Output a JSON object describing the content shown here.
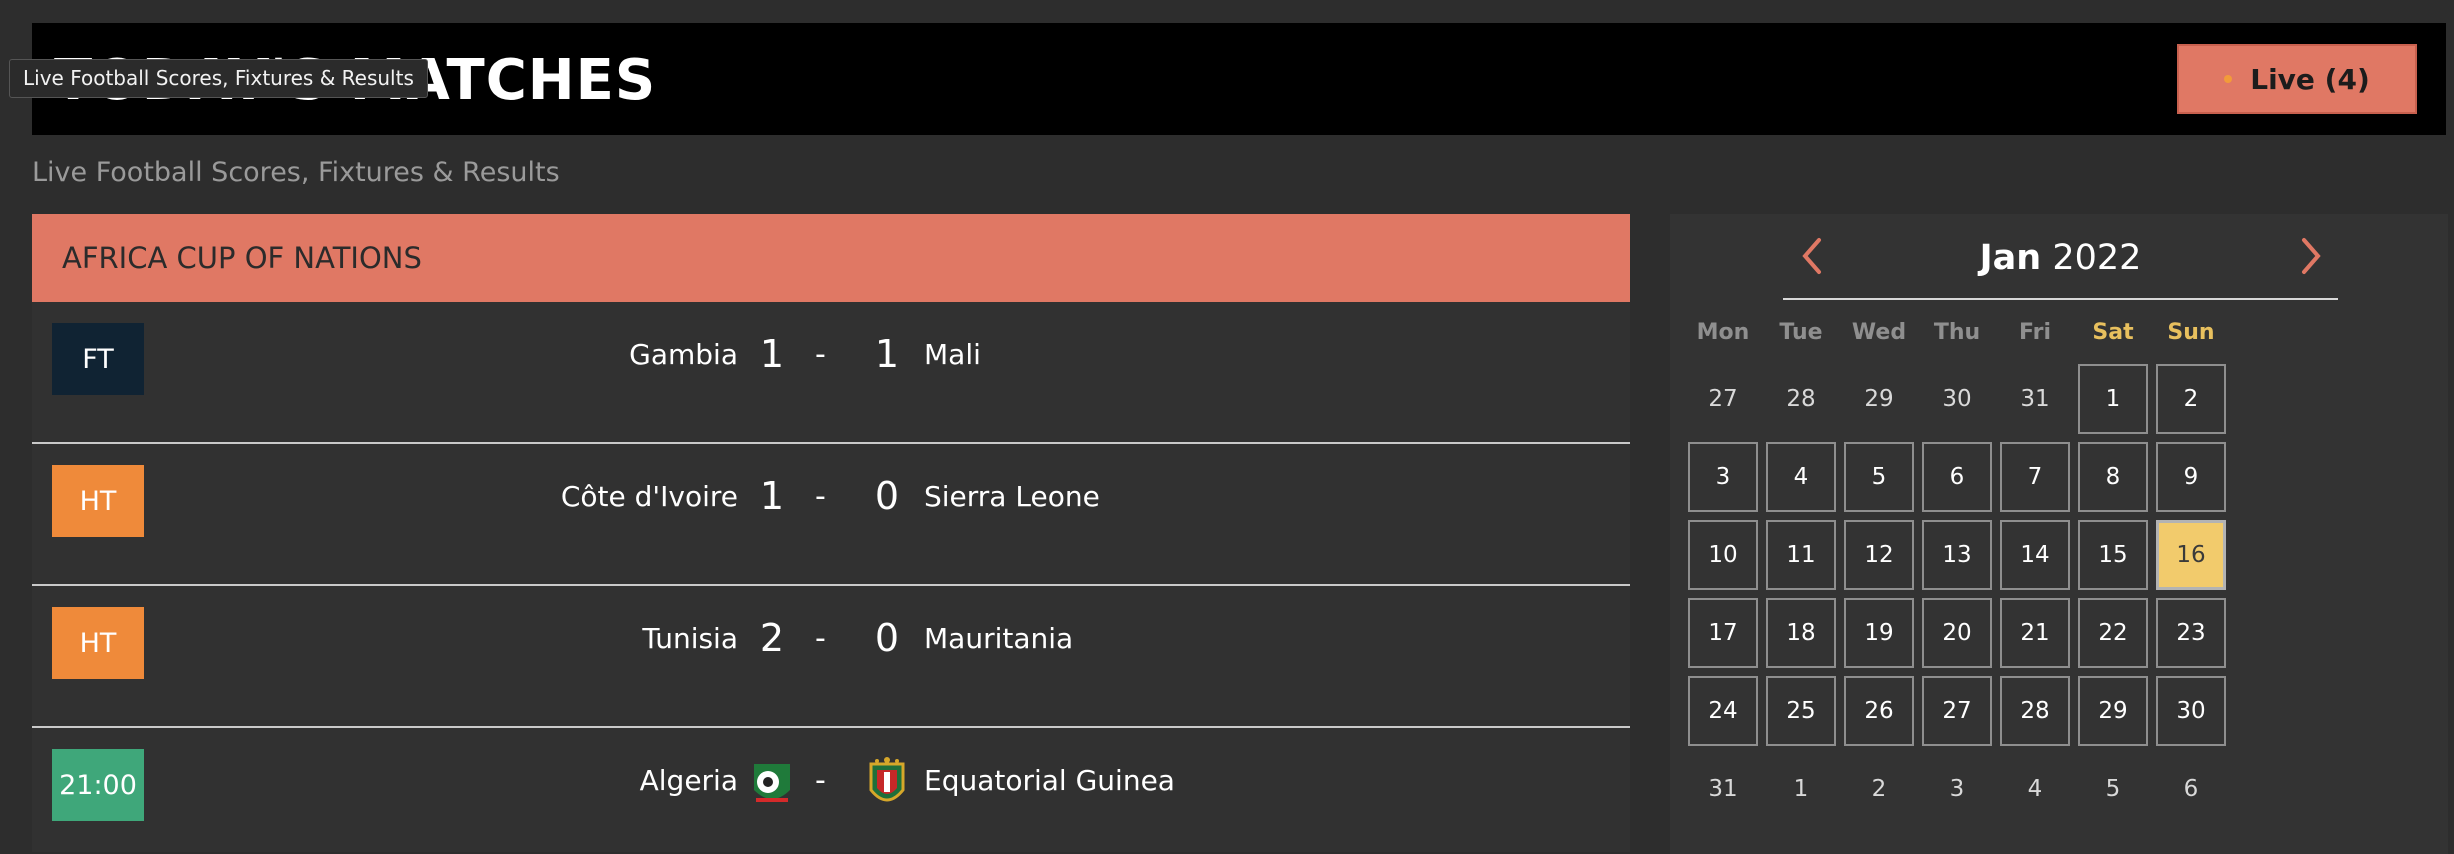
{
  "header": {
    "title": "TODAY'S MATCHES",
    "live_label": "Live (4)",
    "tooltip": "Live Football Scores, Fixtures & Results"
  },
  "subtitle": "Live Football Scores, Fixtures & Results",
  "league": {
    "name": "AFRICA CUP OF NATIONS",
    "matches": [
      {
        "status": "FT",
        "home": "Gambia",
        "home_score": "1",
        "away_score": "1",
        "away": "Mali"
      },
      {
        "status": "HT",
        "home": "Côte d'Ivoire",
        "home_score": "1",
        "away_score": "0",
        "away": "Sierra Leone"
      },
      {
        "status": "HT",
        "home": "Tunisia",
        "home_score": "2",
        "away_score": "0",
        "away": "Mauritania"
      },
      {
        "status": "21:00",
        "home": "Algeria",
        "away": "Equatorial Guinea",
        "separator": "-"
      }
    ]
  },
  "calendar": {
    "month": "Jan",
    "year": "2022",
    "weekdays": [
      "Mon",
      "Tue",
      "Wed",
      "Thu",
      "Fri",
      "Sat",
      "Sun"
    ],
    "selected_day": "16",
    "weeks": [
      [
        "27",
        "28",
        "29",
        "30",
        "31",
        "1",
        "2"
      ],
      [
        "3",
        "4",
        "5",
        "6",
        "7",
        "8",
        "9"
      ],
      [
        "10",
        "11",
        "12",
        "13",
        "14",
        "15",
        "16"
      ],
      [
        "17",
        "18",
        "19",
        "20",
        "21",
        "22",
        "23"
      ],
      [
        "24",
        "25",
        "26",
        "27",
        "28",
        "29",
        "30"
      ],
      [
        "31",
        "1",
        "2",
        "3",
        "4",
        "5",
        "6"
      ]
    ]
  },
  "colors": {
    "accent": "#e07864",
    "ft": "#102333",
    "ht": "#ef8a3a",
    "scheduled": "#3fa77a",
    "selected_day": "#f2cb6c"
  },
  "icons": [
    "chevron-left-icon",
    "chevron-right-icon",
    "live-dot-icon",
    "algeria-crest-icon",
    "equatorial-guinea-crest-icon"
  ]
}
